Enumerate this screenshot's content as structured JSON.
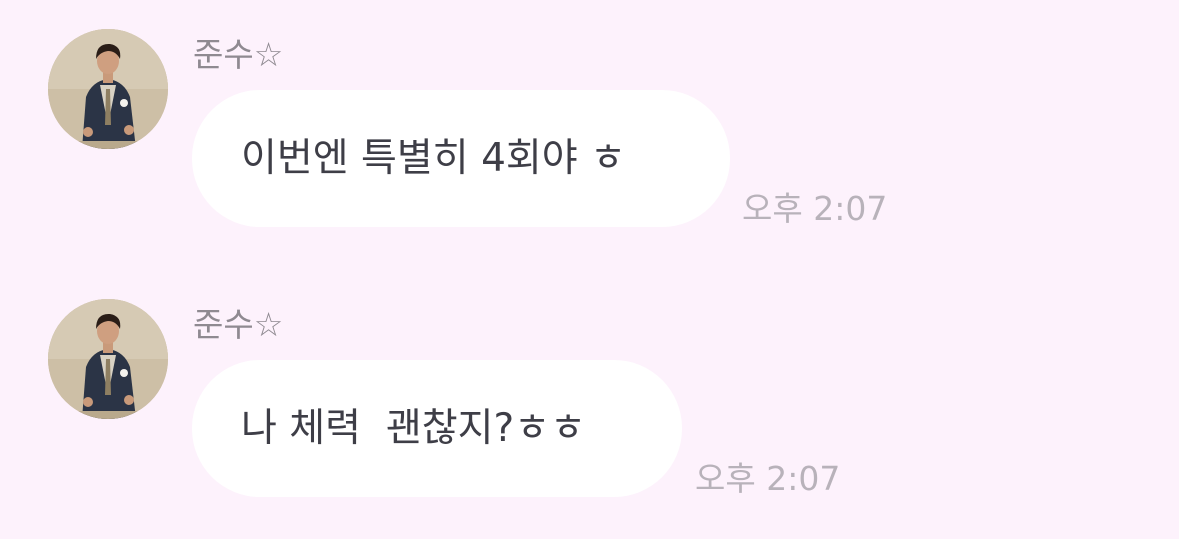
{
  "messages": [
    {
      "sender": "준수☆",
      "text": "이번엔 특별히 4회야 ㅎ",
      "time": "오후 2:07"
    },
    {
      "sender": "준수☆",
      "text": "나 체력  괜찮지?ㅎㅎ",
      "time": "오후 2:07"
    }
  ],
  "colors": {
    "background": "#fdf2fc",
    "bubble": "#ffffff",
    "sender_text": "#8f8a91",
    "message_text": "#3e3e47",
    "time_text": "#b8b2ba"
  },
  "icons": {
    "avatar": "profile-photo"
  }
}
